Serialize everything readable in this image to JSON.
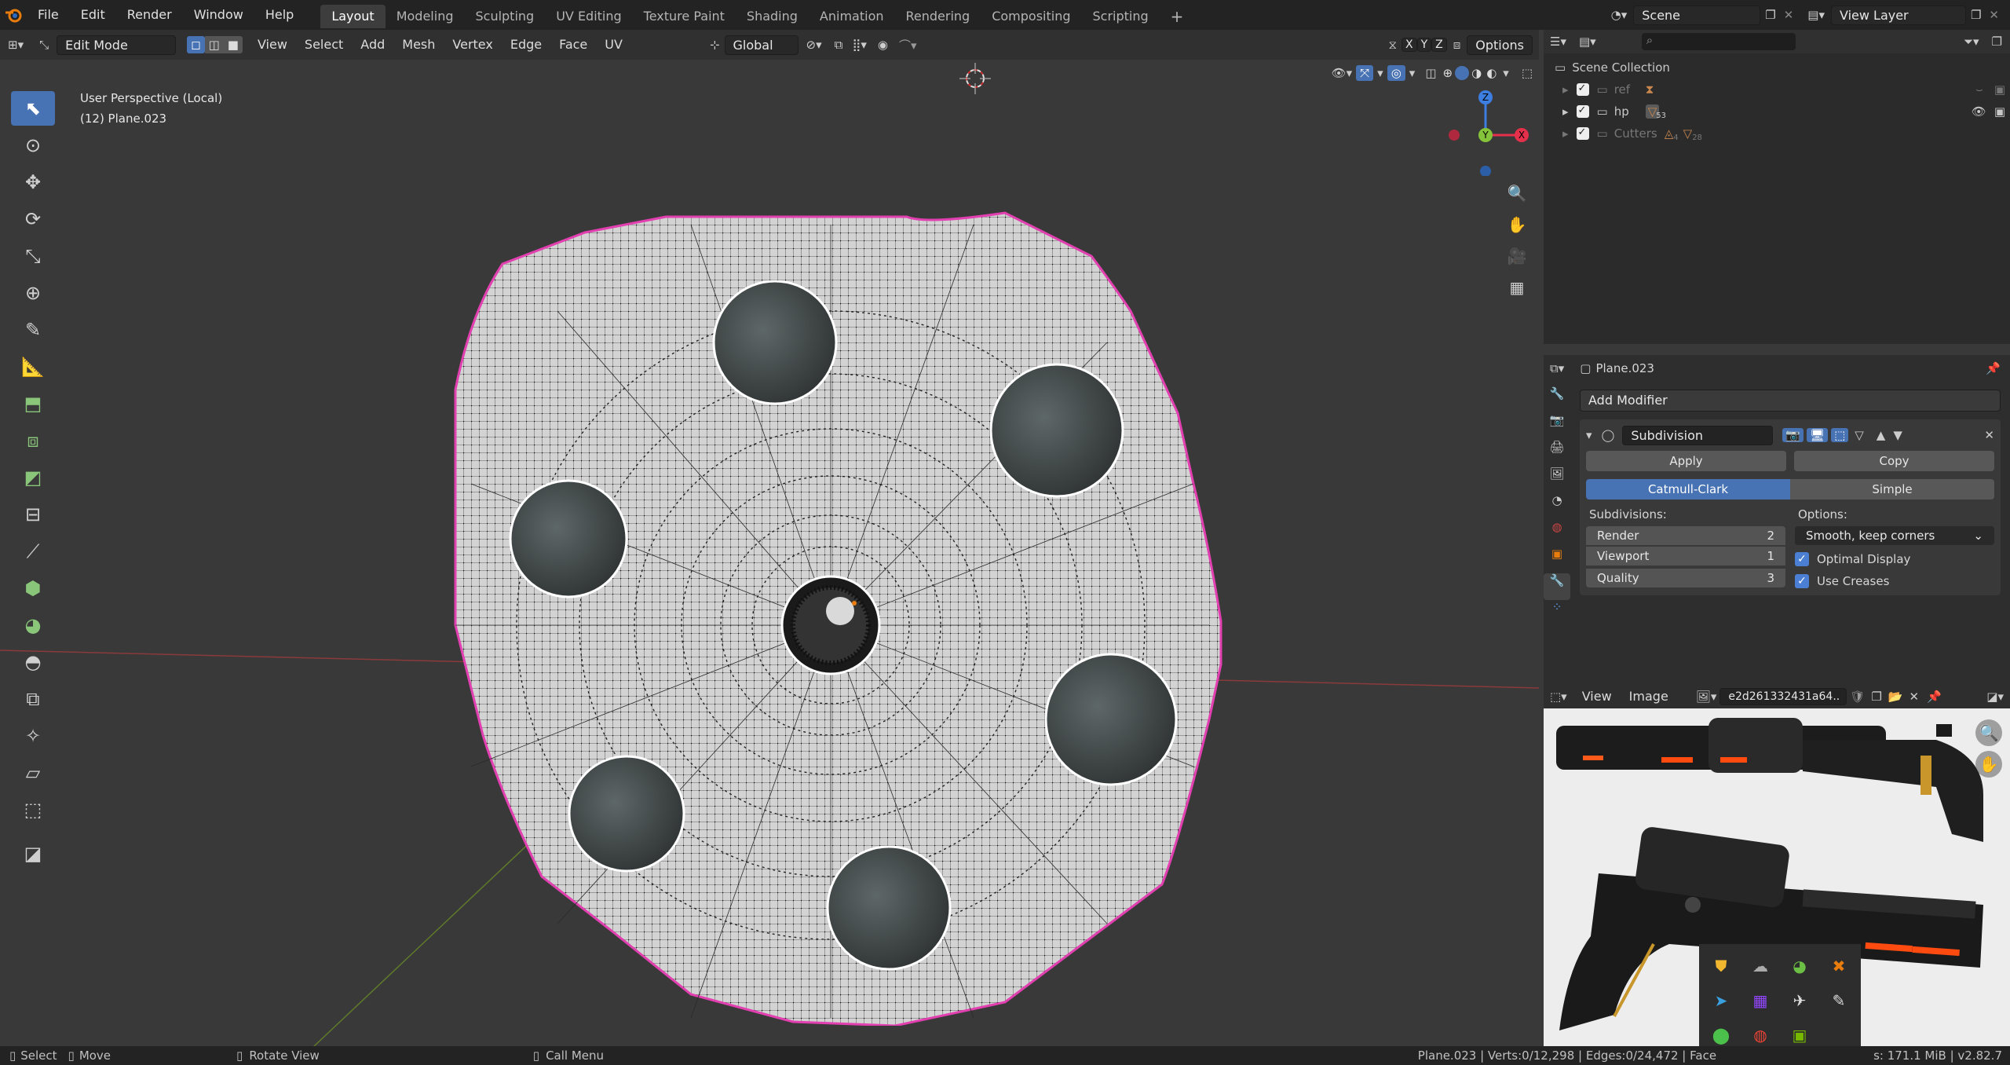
{
  "app_icon": "blender-logo",
  "menus": [
    "File",
    "Edit",
    "Render",
    "Window",
    "Help"
  ],
  "workspaces": [
    "Layout",
    "Modeling",
    "Sculpting",
    "UV Editing",
    "Texture Paint",
    "Shading",
    "Animation",
    "Rendering",
    "Compositing",
    "Scripting"
  ],
  "active_workspace": "Layout",
  "scene_name": "Scene",
  "view_layer": "View Layer",
  "viewport": {
    "mode": "Edit Mode",
    "menus": [
      "View",
      "Select",
      "Add",
      "Mesh",
      "Vertex",
      "Edge",
      "Face",
      "UV"
    ],
    "transform_orientation": "Global",
    "axis_buttons": [
      "X",
      "Y",
      "Z"
    ],
    "options_label": "Options",
    "view_name": "User Perspective (Local)",
    "object_info": "(12) Plane.023",
    "gizmo_labels": {
      "z": "Z",
      "y": "Y",
      "x": "X"
    },
    "colors": {
      "accent": "#4772b3",
      "mesh_outline": "#e23fb0",
      "x_axis": "#e4304a",
      "y_axis": "#85c43a",
      "z_axis": "#3d7fe0"
    }
  },
  "tools": [
    "select-box-icon",
    "cursor-icon",
    "move-icon",
    "rotate-icon",
    "scale-icon",
    "transform-icon",
    "annotate-icon",
    "measure-icon",
    "extrude-icon",
    "inset-icon",
    "bevel-icon",
    "loop-cut-icon",
    "knife-icon",
    "poly-build-icon",
    "spin-icon",
    "smooth-icon",
    "edge-slide-icon",
    "shrink-fatten-icon",
    "shear-icon",
    "rip-icon",
    "add-cube-icon"
  ],
  "outliner": {
    "title": "Scene Collection",
    "items": [
      {
        "name": "ref",
        "badge": ""
      },
      {
        "name": "hp",
        "badge": "53"
      },
      {
        "name": "Cutters",
        "badge": "4",
        "badge2": "28"
      }
    ]
  },
  "properties": {
    "object_name": "Plane.023",
    "add_modifier": "Add Modifier",
    "modifier_name": "Subdivision",
    "apply": "Apply",
    "copy": "Copy",
    "algorithm_a": "Catmull-Clark",
    "algorithm_b": "Simple",
    "subdivisions_label": "Subdivisions:",
    "options_label": "Options:",
    "render_label": "Render",
    "render_value": "2",
    "viewport_label": "Viewport",
    "viewport_value": "1",
    "quality_label": "Quality",
    "quality_value": "3",
    "uv_smooth": "Smooth, keep corners",
    "optimal_display": "Optimal Display",
    "use_creases": "Use Creases"
  },
  "image_editor": {
    "menus": [
      "View",
      "Image"
    ],
    "image_name": "e2d261332431a64.."
  },
  "statusbar": {
    "select": "Select",
    "move": "Move",
    "rotate": "Rotate View",
    "call_menu": "Call Menu",
    "stats": "Plane.023 | Verts:0/12,298 | Edges:0/24,472 | Face",
    "memory": "s: 171.1 MiB | v2.82.7"
  }
}
